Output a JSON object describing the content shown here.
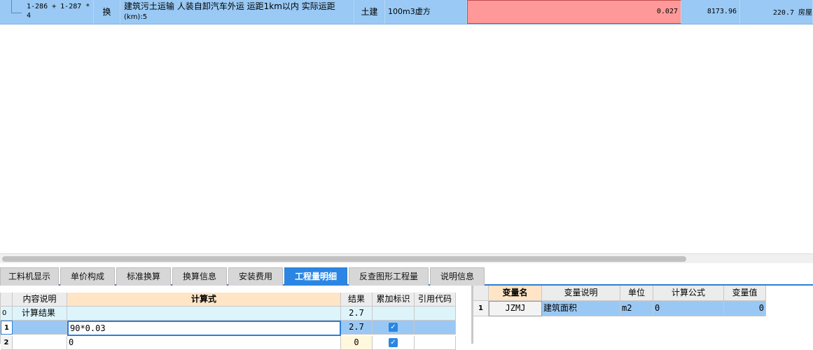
{
  "top_row": {
    "code": "1-286 + 1-287 * 4",
    "type": "换",
    "name_line1": "建筑污土运输 人装自卸汽车外运 运距1km以内  实际运距",
    "name_line2": "(km):5",
    "major": "土建",
    "unit": "100m3虚方",
    "quantity": "0.027",
    "unit_price": "8173.96",
    "total": "220.7 房屋"
  },
  "tabs": [
    {
      "label": "工料机显示",
      "active": false
    },
    {
      "label": "单价构成",
      "active": false
    },
    {
      "label": "标准换算",
      "active": false
    },
    {
      "label": "换算信息",
      "active": false
    },
    {
      "label": "安装费用",
      "active": false
    },
    {
      "label": "工程量明细",
      "active": true
    },
    {
      "label": "反查图形工程量",
      "active": false
    },
    {
      "label": "说明信息",
      "active": false
    }
  ],
  "detail_grid": {
    "headers": {
      "desc": "内容说明",
      "formula": "计算式",
      "result": "结果",
      "accumulate": "累加标识",
      "ref_code": "引用代码"
    },
    "rows": [
      {
        "num": "0",
        "desc": "计算结果",
        "formula": "",
        "result": "2.7",
        "checked": false
      },
      {
        "num": "1",
        "desc": "",
        "formula": "90*0.03",
        "result": "2.7",
        "checked": true
      },
      {
        "num": "2",
        "desc": "",
        "formula": "0",
        "result": "0",
        "checked": true
      }
    ]
  },
  "var_grid": {
    "headers": {
      "name": "变量名",
      "desc": "变量说明",
      "unit": "单位",
      "formula": "计算公式",
      "value": "变量值"
    },
    "rows": [
      {
        "num": "1",
        "name": "JZMJ",
        "desc": "建筑面积",
        "unit": "m2",
        "formula": "0",
        "value": "0"
      }
    ]
  },
  "colors": {
    "selected_row": "#99c9f4",
    "quantity_highlight": "#ff9999",
    "active_tab": "#2b86e3",
    "formula_header": "#ffe5c6"
  }
}
